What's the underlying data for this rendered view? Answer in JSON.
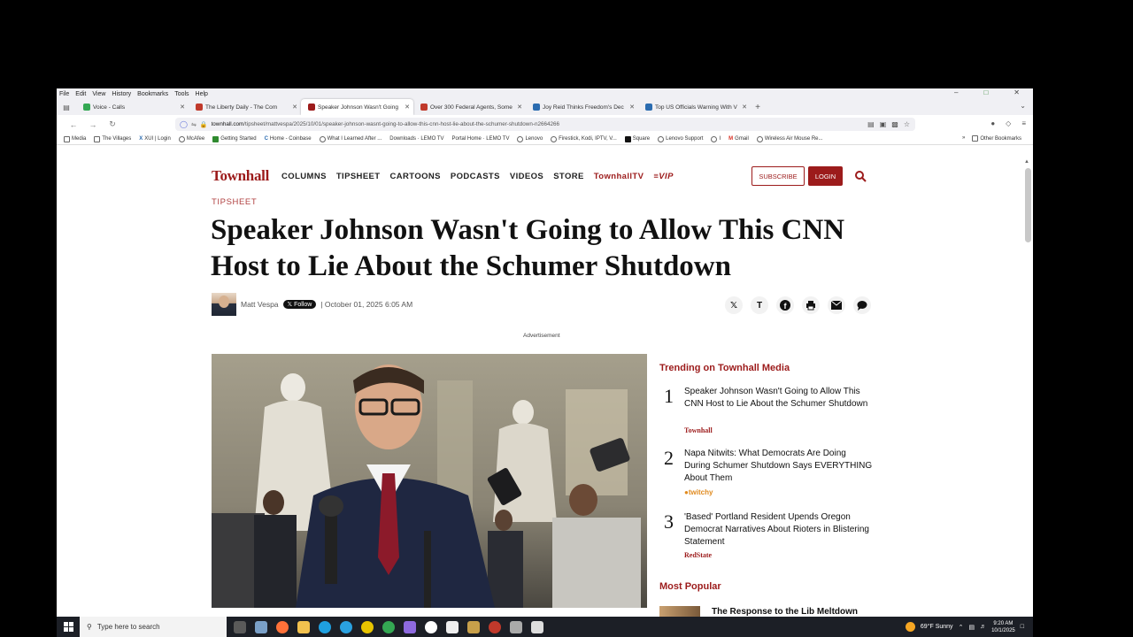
{
  "menu": [
    "File",
    "Edit",
    "View",
    "History",
    "Bookmarks",
    "Tools",
    "Help"
  ],
  "tabs": [
    {
      "title": "Voice - Calls",
      "color": "#34a853",
      "active": false
    },
    {
      "title": "The Liberty Daily - The Com",
      "color": "#c0392b",
      "active": false
    },
    {
      "title": "Speaker Johnson Wasn't Going",
      "color": "#9c1b1b",
      "active": true
    },
    {
      "title": "Over 300 Federal Agents, Some",
      "color": "#c0392b",
      "active": false
    },
    {
      "title": "Joy Reid Thinks Freedom's Dec",
      "color": "#2b6cb0",
      "active": false
    },
    {
      "title": "Top US Officials Warning With V",
      "color": "#2b6cb0",
      "active": false
    }
  ],
  "url": {
    "domain": "townhall.com",
    "path": "/tipsheet/mattvespa/2025/10/01/speaker-johnson-wasnt-going-to-allow-this-cnn-host-lie-about-the-schumer-shutdown-n2664266"
  },
  "bookmarks": [
    "Media",
    "The Villages",
    "XUI | Login",
    "McAfee",
    "Getting Started",
    "Home - Coinbase",
    "What I Learned After ...",
    "Downloads · LEMO TV",
    "Portal Home · LEMO TV",
    "Lenovo",
    "Firestick, Kodi, IPTV, V...",
    "Square",
    "Lenovo Support",
    "I",
    "Gmail",
    "Wireless Air Mouse Re..."
  ],
  "bookmarks_other": "Other Bookmarks",
  "site": {
    "logo": "Townhall",
    "nav": [
      "COLUMNS",
      "TIPSHEET",
      "CARTOONS",
      "PODCASTS",
      "VIDEOS",
      "STORE"
    ],
    "nav_tv": "TownhallTV",
    "nav_vip": "≡VIP",
    "subscribe": "SUBSCRIBE",
    "login": "LOGIN"
  },
  "article": {
    "section": "TIPSHEET",
    "headline": "Speaker Johnson Wasn't Going to Allow This CNN Host to Lie About the Schumer Shutdown",
    "author": "Matt Vespa",
    "follow": "Follow",
    "date": "| October 01, 2025 6:05 AM",
    "ad_label": "Advertisement"
  },
  "share_icons": [
    "x-icon",
    "townhall-icon",
    "facebook-icon",
    "print-icon",
    "email-icon",
    "comment-icon"
  ],
  "trending": {
    "title": "Trending on Townhall Media",
    "items": [
      {
        "num": "1",
        "text": "Speaker Johnson Wasn't Going to Allow This CNN Host to Lie About the Schumer Shutdown",
        "source": "Townhall"
      },
      {
        "num": "2",
        "text": "Napa Nitwits: What Democrats Are Doing During Schumer Shutdown Says EVERYTHING About Them",
        "source": "twitchy"
      },
      {
        "num": "3",
        "text": "'Based' Portland Resident Upends Oregon Democrat Narratives About Rioters in Blistering Statement",
        "source": "RedState"
      }
    ]
  },
  "most_popular": {
    "title": "Most Popular",
    "first": "The Response to the Lib Meltdown"
  },
  "taskbar": {
    "search_placeholder": "Type here to search",
    "weather": "69°F  Sunny",
    "time": "9:20 AM",
    "date": "10/1/2025"
  }
}
